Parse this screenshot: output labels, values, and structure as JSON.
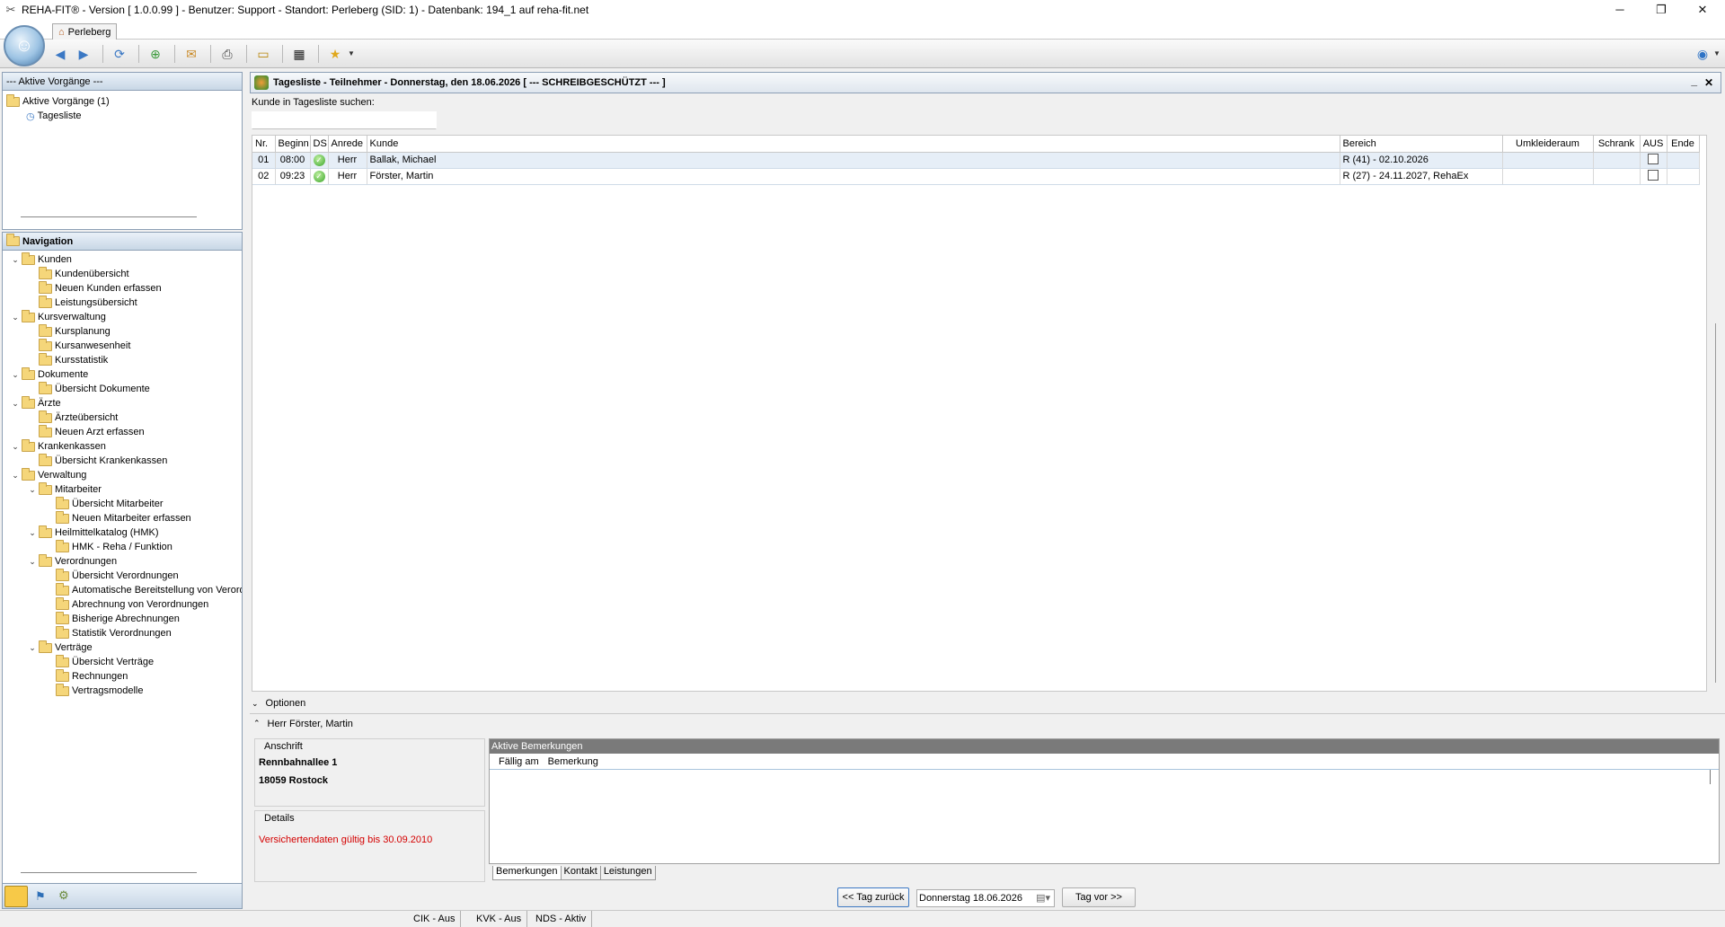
{
  "window": {
    "title": "REHA-FIT® - Version [ 1.0.0.99 ] - Benutzer: Support - Standort: Perleberg  (SID: 1) - Datenbank: 194_1 auf reha-fit.net",
    "minimize": "─",
    "maximize": "❐",
    "close": "✕"
  },
  "tab": {
    "label": "Perleberg"
  },
  "active_tasks": {
    "header": "--- Aktive Vorgänge ---",
    "root": "Aktive Vorgänge (1)",
    "child": "Tagesliste"
  },
  "navigation": {
    "header": "Navigation",
    "items": [
      {
        "label": "Kunden",
        "level": 0,
        "expanded": true
      },
      {
        "label": "Kundenübersicht",
        "level": 1
      },
      {
        "label": "Neuen Kunden erfassen",
        "level": 1
      },
      {
        "label": "Leistungsübersicht",
        "level": 1
      },
      {
        "label": "Kursverwaltung",
        "level": 0,
        "expanded": true
      },
      {
        "label": "Kursplanung",
        "level": 1
      },
      {
        "label": "Kursanwesenheit",
        "level": 1
      },
      {
        "label": "Kursstatistik",
        "level": 1
      },
      {
        "label": "Dokumente",
        "level": 0,
        "expanded": true
      },
      {
        "label": "Übersicht Dokumente",
        "level": 1
      },
      {
        "label": "Ärzte",
        "level": 0,
        "expanded": true
      },
      {
        "label": "Ärzteübersicht",
        "level": 1
      },
      {
        "label": "Neuen Arzt erfassen",
        "level": 1
      },
      {
        "label": "Krankenkassen",
        "level": 0,
        "expanded": true
      },
      {
        "label": "Übersicht Krankenkassen",
        "level": 1
      },
      {
        "label": "Verwaltung",
        "level": 0,
        "expanded": true
      },
      {
        "label": "Mitarbeiter",
        "level": 1,
        "expanded": true
      },
      {
        "label": "Übersicht Mitarbeiter",
        "level": 2
      },
      {
        "label": "Neuen Mitarbeiter erfassen",
        "level": 2
      },
      {
        "label": "Heilmittelkatalog (HMK)",
        "level": 1,
        "expanded": true
      },
      {
        "label": "HMK - Reha / Funktion",
        "level": 2
      },
      {
        "label": "Verordnungen",
        "level": 1,
        "expanded": true
      },
      {
        "label": "Übersicht Verordnungen",
        "level": 2
      },
      {
        "label": "Automatische Bereitstellung von Verordnungen",
        "level": 2
      },
      {
        "label": "Abrechnung von Verordnungen",
        "level": 2
      },
      {
        "label": "Bisherige Abrechnungen",
        "level": 2
      },
      {
        "label": "Statistik Verordnungen",
        "level": 2
      },
      {
        "label": "Verträge",
        "level": 1,
        "expanded": true
      },
      {
        "label": "Übersicht Verträge",
        "level": 2
      },
      {
        "label": "Rechnungen",
        "level": 2
      },
      {
        "label": "Vertragsmodelle",
        "level": 2
      }
    ]
  },
  "main": {
    "title": "Tagesliste - Teilnehmer - Donnerstag, den 18.06.2026 [ --- SCHREIBGESCHÜTZT --- ]",
    "search_label": "Kunde in Tagesliste suchen:",
    "search_value": "",
    "columns": [
      "Nr.",
      "Beginn",
      "DS",
      "Anrede",
      "Kunde",
      "Bereich",
      "Umkleideraum",
      "Schrank",
      "AUS",
      "Ende"
    ],
    "rows": [
      {
        "nr": "01",
        "beginn": "08:00",
        "anrede": "Herr",
        "kunde": "Ballak, Michael",
        "bereich": "R (41) - 02.10.2026",
        "umkleideraum": "",
        "schrank": "",
        "ende": ""
      },
      {
        "nr": "02",
        "beginn": "09:23",
        "anrede": "Herr",
        "kunde": "Förster, Martin",
        "bereich": "R (27) - 24.11.2027, RehaEx",
        "umkleideraum": "",
        "schrank": "",
        "ende": ""
      }
    ],
    "optionen_label": "Optionen",
    "selected_person": "Herr Förster, Martin"
  },
  "details": {
    "anschrift_label": "Anschrift",
    "street": "Rennbahnallee 1",
    "city": "18059 Rostock",
    "details_label": "Details",
    "warning": "Versichertendaten gültig bis 30.09.2010",
    "warning_color": "#d40000"
  },
  "remarks": {
    "header": "Aktive Bemerkungen",
    "col_due": "Fällig am",
    "col_remark": "Bemerkung",
    "tabs": [
      "Bemerkungen",
      "Kontakt",
      "Leistungen"
    ]
  },
  "date_nav": {
    "prev": "<< Tag zurück",
    "date": "Donnerstag 18.06.2026",
    "next": "Tag vor >>"
  },
  "statusbar": [
    "CIK - Aus",
    "KVK - Aus",
    "NDS - Aktiv"
  ],
  "colors": {
    "accent": "#3c78c3",
    "header_gray": "#7a7a7a"
  }
}
